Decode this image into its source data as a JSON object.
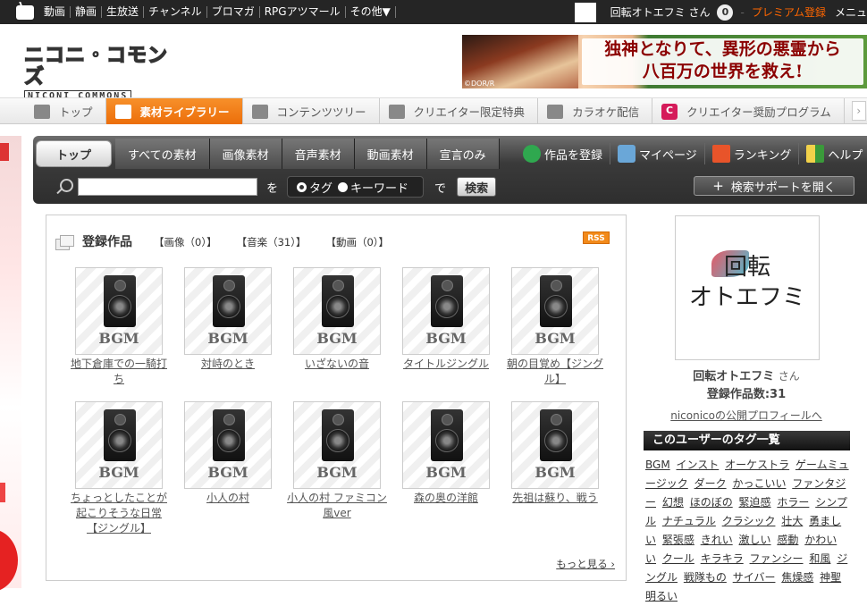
{
  "topbar": {
    "nav": [
      "動画",
      "静画",
      "生放送",
      "チャンネル",
      "ブロマガ",
      "RPGアツマール",
      "その他▼"
    ],
    "user_name": "回転オトエフミ さん",
    "notifications": "0",
    "separator": "-",
    "premium": "プレミアム登録",
    "menu": "メニュ"
  },
  "header": {
    "logo_main": "ニコニ・コモンズ",
    "logo_sub": "NICONI COMMONS",
    "banner_line1": "独神となりて、異形の悪霊から",
    "banner_line2": "八百万の世界を救え!",
    "banner_copyright": "©DOR/R"
  },
  "catnav": {
    "items": [
      "トップ",
      "素材ライブラリー",
      "コンテンツツリー",
      "クリエイター限定特典",
      "カラオケ配信",
      "クリエイター奨励プログラム"
    ],
    "next": "›"
  },
  "toolbar": {
    "tabs": [
      "トップ",
      "すべての素材",
      "画像素材",
      "音声素材",
      "動画素材",
      "宣言のみ"
    ],
    "tools": [
      "作品を登録",
      "マイページ",
      "ランキング",
      "ヘルプ"
    ],
    "search_value": "",
    "wo": "を",
    "radio_tag": "タグ",
    "radio_keyword": "キーワード",
    "de": "で",
    "search_button": "検索",
    "support_plus": "+",
    "support_button": "検索サポートを開く"
  },
  "works": {
    "title": "登録作品",
    "filters": [
      "【画像（0）】",
      "【音楽（31）】",
      "【動画（0）】"
    ],
    "rss": "RSS",
    "thumb_label": "BGM",
    "items": [
      "地下倉庫での一騎打ち",
      "対峙のとき",
      "いざないの音",
      "タイトルジングル",
      "朝の目覚め【ジングル】",
      "ちょっとしたことが起こりそうな日常【ジングル】",
      "小人の村",
      "小人の村 ファミコン風ver",
      "森の奥の洋館",
      "先祖は蘇り、戦う"
    ],
    "more": "もっと見る ›"
  },
  "profile": {
    "logo_line1": "回転",
    "logo_line2": "オトエフミ",
    "name": "回転オトエフミ",
    "san": "さん",
    "count": "登録作品数:31",
    "link": "niconicoの公開プロフィールへ",
    "tags_title": "このユーザーのタグ一覧",
    "tags": [
      "BGM",
      "インスト",
      "オーケストラ",
      "ゲームミュージック",
      "ダーク",
      "かっこいい",
      "ファンタジー",
      "幻想",
      "ほのぼの",
      "緊迫感",
      "ホラー",
      "シンプル",
      "ナチュラル",
      "クラシック",
      "壮大",
      "勇ましい",
      "緊張感",
      "きれい",
      "激しい",
      "感動",
      "かわいい",
      "クール",
      "キラキラ",
      "ファンシー",
      "和風",
      "ジングル",
      "戦隊もの",
      "サイバー",
      "焦燥感",
      "神聖",
      "明るい"
    ]
  },
  "colors": {
    "accent": "#f7902a",
    "premium": "#ff6600",
    "topbar": "#252525"
  }
}
